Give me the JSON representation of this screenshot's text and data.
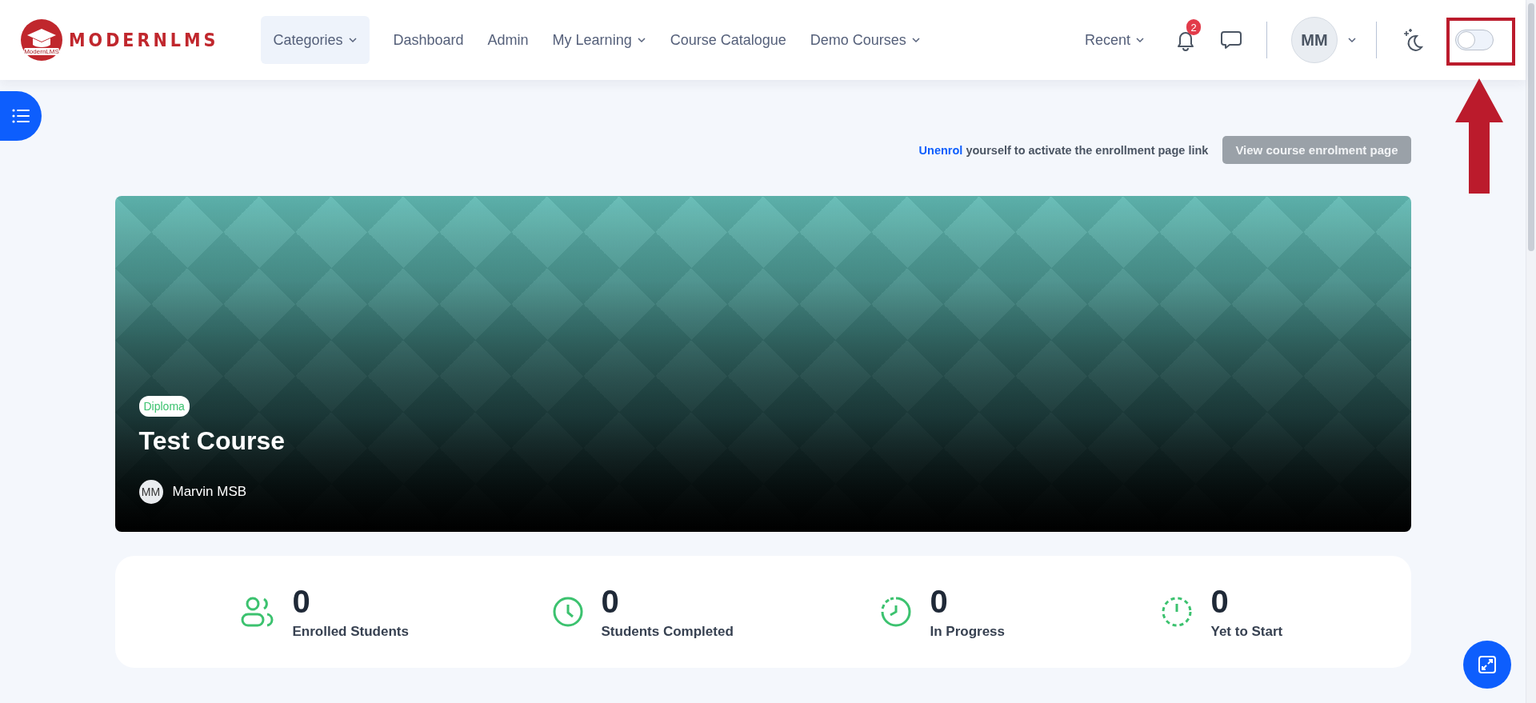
{
  "logo": {
    "text": "MODERNLMS",
    "subtext": "ModernLMS"
  },
  "nav": [
    {
      "label": "Categories",
      "dropdown": true,
      "selected": true
    },
    {
      "label": "Dashboard",
      "dropdown": false,
      "selected": false
    },
    {
      "label": "Admin",
      "dropdown": false,
      "selected": false
    },
    {
      "label": "My Learning",
      "dropdown": true,
      "selected": false
    },
    {
      "label": "Course Catalogue",
      "dropdown": false,
      "selected": false
    },
    {
      "label": "Demo Courses",
      "dropdown": true,
      "selected": false
    }
  ],
  "header_right": {
    "recent": {
      "label": "Recent"
    },
    "notifications": {
      "count": "2"
    },
    "user": {
      "initials": "MM"
    },
    "dark_mode": {
      "on": false
    }
  },
  "annotation": {
    "frame": true,
    "arrow": true
  },
  "enrolment": {
    "link": "Unenrol",
    "message": "yourself to activate the enrollment page link",
    "button": "View course enrolment page",
    "button_disabled": true
  },
  "course": {
    "category": "Diploma",
    "title": "Test Course",
    "teacher": {
      "initials": "MM",
      "name": "Marvin MSB"
    }
  },
  "stats": [
    {
      "kind": "users",
      "value": "0",
      "label": "Enrolled Students"
    },
    {
      "kind": "clock",
      "value": "0",
      "label": "Students Completed"
    },
    {
      "kind": "progress",
      "value": "0",
      "label": "In Progress"
    },
    {
      "kind": "pending",
      "value": "0",
      "label": "Yet to Start"
    }
  ]
}
